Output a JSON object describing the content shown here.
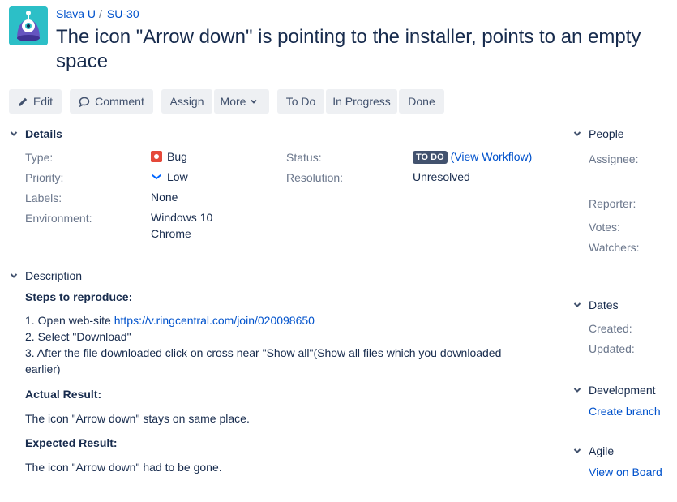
{
  "breadcrumb": {
    "project": "Slava U",
    "separator": "/",
    "issue_key": "SU-30"
  },
  "issue": {
    "title": "The icon \"Arrow down\" is pointing to the installer, points to an empty space"
  },
  "toolbar": {
    "edit": "Edit",
    "comment": "Comment",
    "assign": "Assign",
    "more": "More",
    "todo": "To Do",
    "in_progress": "In Progress",
    "done": "Done"
  },
  "details": {
    "heading": "Details",
    "type_label": "Type:",
    "type_value": "Bug",
    "priority_label": "Priority:",
    "priority_value": "Low",
    "labels_label": "Labels:",
    "labels_value": "None",
    "environment_label": "Environment:",
    "environment_line1": "Windows 10",
    "environment_line2": "Chrome",
    "status_label": "Status:",
    "status_value": "TO DO",
    "view_workflow": "(View Workflow)",
    "resolution_label": "Resolution:",
    "resolution_value": "Unresolved"
  },
  "description": {
    "heading": "Description",
    "steps_heading": "Steps to reproduce:",
    "step1_prefix": "1. Open web-site ",
    "step1_link": "https://v.ringcentral.com/join/020098650",
    "step2": "2. Select \"Download\"",
    "step3_line1": "3. After the file downloaded click on cross near \"Show all\"(Show all files which you downloaded",
    "step3_line2": "earlier)",
    "actual_heading": "Actual Result:",
    "actual_text": "The icon \"Arrow down\" stays on same place.",
    "expected_heading": "Expected Result:",
    "expected_text": "The icon \"Arrow down\" had to be gone."
  },
  "people": {
    "heading": "People",
    "assignee": "Assignee:",
    "reporter": "Reporter:",
    "votes": "Votes:",
    "watchers": "Watchers:"
  },
  "dates": {
    "heading": "Dates",
    "created": "Created:",
    "updated": "Updated:"
  },
  "development": {
    "heading": "Development",
    "create_branch": "Create branch"
  },
  "agile": {
    "heading": "Agile",
    "view_on_board": "View on Board"
  },
  "colors": {
    "link": "#0052cc",
    "text": "#172b4d",
    "muted": "#6b778c",
    "button_bg": "#eef0f3",
    "bug": "#e5493a",
    "lozenge": "#42526e"
  }
}
